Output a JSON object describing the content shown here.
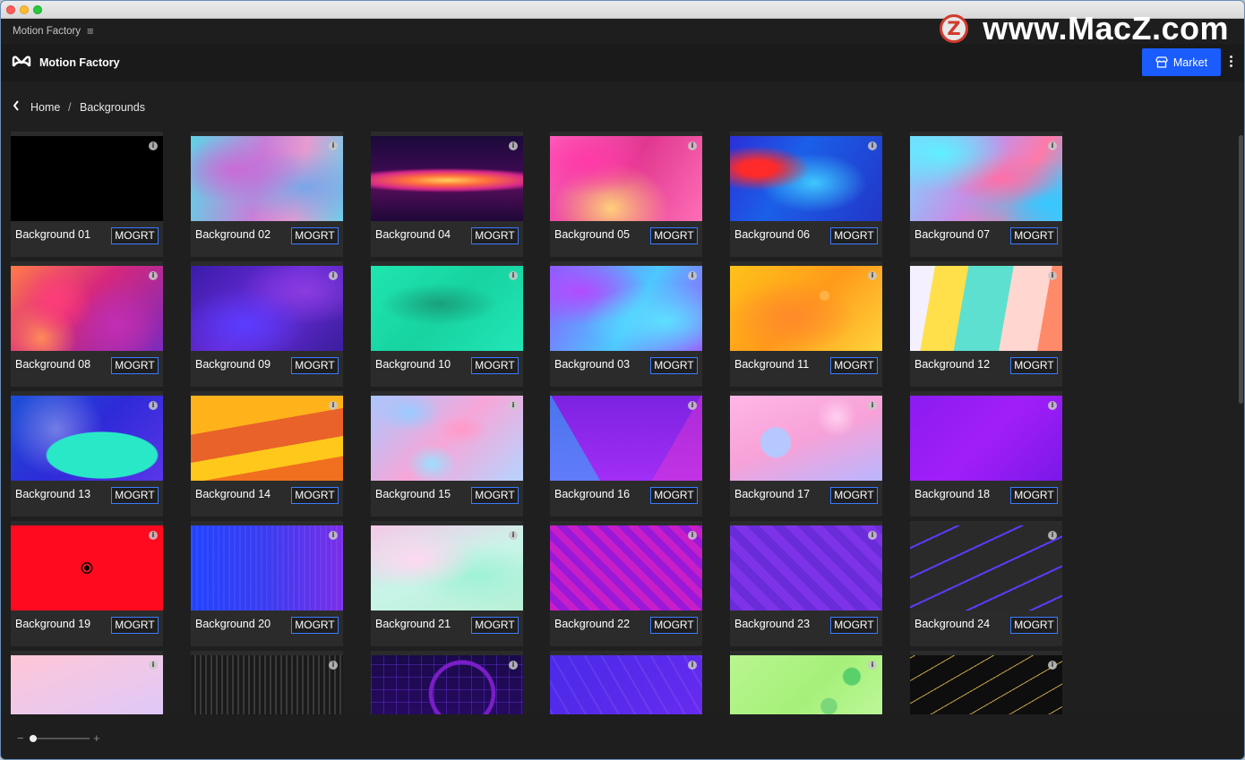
{
  "panel": {
    "title": "Motion Factory",
    "menu_icon": "hamburger-icon"
  },
  "watermark": {
    "logo_letter": "Z",
    "text": "www.MacZ.com"
  },
  "header": {
    "title": "Motion Factory",
    "market_label": "Market"
  },
  "breadcrumb": {
    "home": "Home",
    "separator": "/",
    "current": "Backgrounds"
  },
  "cards": [
    {
      "name": "Background 01",
      "badge": "MOGRT",
      "info": "i"
    },
    {
      "name": "Background 02",
      "badge": "MOGRT",
      "info": "i"
    },
    {
      "name": "Background 04",
      "badge": "MOGRT",
      "info": "i"
    },
    {
      "name": "Background 05",
      "badge": "MOGRT",
      "info": "i"
    },
    {
      "name": "Background 06",
      "badge": "MOGRT",
      "info": "i"
    },
    {
      "name": "Background 07",
      "badge": "MOGRT",
      "info": "i"
    },
    {
      "name": "Background 08",
      "badge": "MOGRT",
      "info": "i"
    },
    {
      "name": "Background 09",
      "badge": "MOGRT",
      "info": "i"
    },
    {
      "name": "Background 10",
      "badge": "MOGRT",
      "info": "i"
    },
    {
      "name": "Background 03",
      "badge": "MOGRT",
      "info": "i"
    },
    {
      "name": "Background 11",
      "badge": "MOGRT",
      "info": "i"
    },
    {
      "name": "Background 12",
      "badge": "MOGRT",
      "info": "i"
    },
    {
      "name": "Background 13",
      "badge": "MOGRT",
      "info": "i"
    },
    {
      "name": "Background 14",
      "badge": "MOGRT",
      "info": "i"
    },
    {
      "name": "Background 15",
      "badge": "MOGRT",
      "info": "i"
    },
    {
      "name": "Background 16",
      "badge": "MOGRT",
      "info": "i"
    },
    {
      "name": "Background 17",
      "badge": "MOGRT",
      "info": "i"
    },
    {
      "name": "Background 18",
      "badge": "MOGRT",
      "info": "i"
    },
    {
      "name": "Background 19",
      "badge": "MOGRT",
      "info": "i"
    },
    {
      "name": "Background 20",
      "badge": "MOGRT",
      "info": "i"
    },
    {
      "name": "Background 21",
      "badge": "MOGRT",
      "info": "i"
    },
    {
      "name": "Background 22",
      "badge": "MOGRT",
      "info": "i"
    },
    {
      "name": "Background 23",
      "badge": "MOGRT",
      "info": "i"
    },
    {
      "name": "Background 24",
      "badge": "MOGRT",
      "info": "i"
    },
    {
      "name": "",
      "badge": "",
      "info": "i"
    },
    {
      "name": "",
      "badge": "",
      "info": "i"
    },
    {
      "name": "",
      "badge": "",
      "info": "i"
    },
    {
      "name": "",
      "badge": "",
      "info": "i"
    },
    {
      "name": "",
      "badge": "",
      "info": "i"
    },
    {
      "name": "",
      "badge": "",
      "info": "i"
    }
  ],
  "zoom": {
    "minus": "−",
    "plus": "+"
  },
  "colors": {
    "accent": "#1a5cff",
    "badge_border": "#3b7bff",
    "background": "#1f1f1f"
  }
}
